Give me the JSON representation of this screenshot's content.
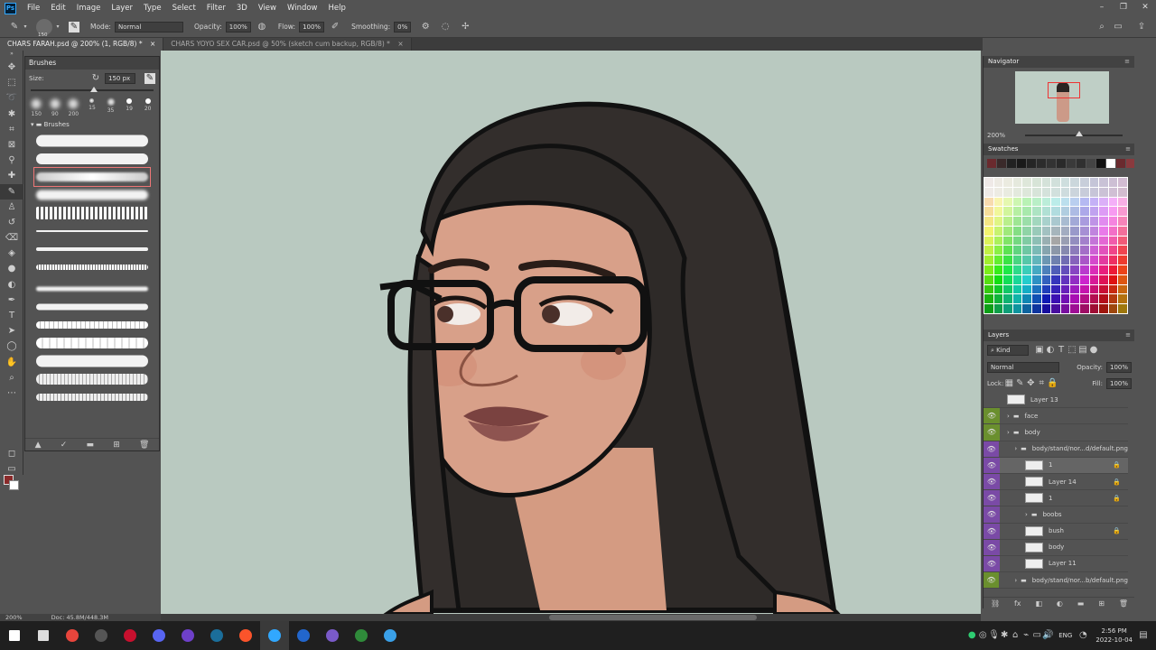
{
  "menubar": {
    "app_icon": "Ps",
    "items": [
      "File",
      "Edit",
      "Image",
      "Layer",
      "Type",
      "Select",
      "Filter",
      "3D",
      "View",
      "Window",
      "Help"
    ],
    "window_controls": [
      "–",
      "❐",
      "✕"
    ]
  },
  "options": {
    "brush_size": "150",
    "mode_label": "Mode:",
    "mode_value": "Normal",
    "opacity_label": "Opacity:",
    "opacity_value": "100%",
    "flow_label": "Flow:",
    "flow_value": "100%",
    "smoothing_label": "Smoothing:",
    "smoothing_value": "0%"
  },
  "tabs": [
    {
      "label": "CHARS FARAH.psd @ 200% (1, RGB/8) *",
      "close": "×",
      "active": true
    },
    {
      "label": "CHARS YOYO SEX CAR.psd @ 50% (sketch cum backup, RGB/8) *",
      "close": "×",
      "active": false
    }
  ],
  "brushes": {
    "title": "Brushes",
    "size_label": "Size:",
    "size_value": "150 px",
    "presets": [
      "150",
      "90",
      "200",
      "15",
      "35",
      "19",
      "20"
    ],
    "folder": "Brushes",
    "selected_index": 2
  },
  "statusbar": {
    "zoom": "200%",
    "doc": "Doc: 45.8M/448.3M"
  },
  "navigator": {
    "title": "Navigator",
    "zoom": "200%"
  },
  "swatches": {
    "title": "Swatches"
  },
  "layers": {
    "title": "Layers",
    "filter_kind": "Kind",
    "blend_mode": "Normal",
    "opacity_label": "Opacity:",
    "opacity_value": "100%",
    "lock_label": "Lock:",
    "fill_label": "Fill:",
    "fill_value": "100%",
    "items": [
      {
        "name": "Layer 13",
        "color": "",
        "visible": false,
        "indent": 0,
        "folder": false,
        "locked": false
      },
      {
        "name": "face",
        "color": "#6a8f2e",
        "visible": true,
        "indent": 0,
        "folder": true,
        "locked": false
      },
      {
        "name": "body",
        "color": "#6a8f2e",
        "visible": true,
        "indent": 0,
        "folder": true,
        "locked": false
      },
      {
        "name": "body/stand/nor...d/default.png",
        "color": "#7a4aa6",
        "visible": true,
        "indent": 1,
        "folder": true,
        "locked": false
      },
      {
        "name": "1",
        "color": "#7a4aa6",
        "visible": true,
        "indent": 2,
        "folder": false,
        "locked": true,
        "selected": true
      },
      {
        "name": "Layer 14",
        "color": "#7a4aa6",
        "visible": true,
        "indent": 2,
        "folder": false,
        "locked": true
      },
      {
        "name": "1",
        "color": "#7a4aa6",
        "visible": true,
        "indent": 2,
        "folder": false,
        "locked": true
      },
      {
        "name": "boobs",
        "color": "#7a4aa6",
        "visible": true,
        "indent": 2,
        "folder": true,
        "locked": false
      },
      {
        "name": "bush",
        "color": "#7a4aa6",
        "visible": true,
        "indent": 2,
        "folder": false,
        "locked": true
      },
      {
        "name": "body",
        "color": "#7a4aa6",
        "visible": true,
        "indent": 2,
        "folder": false,
        "locked": false
      },
      {
        "name": "Layer 11",
        "color": "#7a4aa6",
        "visible": true,
        "indent": 2,
        "folder": false,
        "locked": false
      },
      {
        "name": "body/stand/nor...b/default.png",
        "color": "#6a8f2e",
        "visible": true,
        "indent": 1,
        "folder": true,
        "locked": false
      }
    ]
  },
  "taskbar": {
    "apps": [
      {
        "name": "windows-start-icon",
        "color": "#ffffff"
      },
      {
        "name": "task-view-icon",
        "color": "#dddddd"
      },
      {
        "name": "chrome-icon",
        "color": "#e8453c"
      },
      {
        "name": "obs-icon",
        "color": "#555555"
      },
      {
        "name": "red-app-icon",
        "color": "#c8102e"
      },
      {
        "name": "discord-icon",
        "color": "#5865f2"
      },
      {
        "name": "github-icon",
        "color": "#6e40c9"
      },
      {
        "name": "steam-icon",
        "color": "#1b6e9a"
      },
      {
        "name": "brave-icon",
        "color": "#fb542b"
      },
      {
        "name": "photoshop-icon",
        "color": "#31a8ff"
      },
      {
        "name": "vpn-icon",
        "color": "#2266cc"
      },
      {
        "name": "folder-app-icon",
        "color": "#7a5ac8"
      },
      {
        "name": "game-icon",
        "color": "#2f8a3a"
      },
      {
        "name": "monitor-icon",
        "color": "#3aa0e8"
      }
    ],
    "lang": "ENG",
    "time": "2:56 PM",
    "date": "2022-10-04"
  }
}
